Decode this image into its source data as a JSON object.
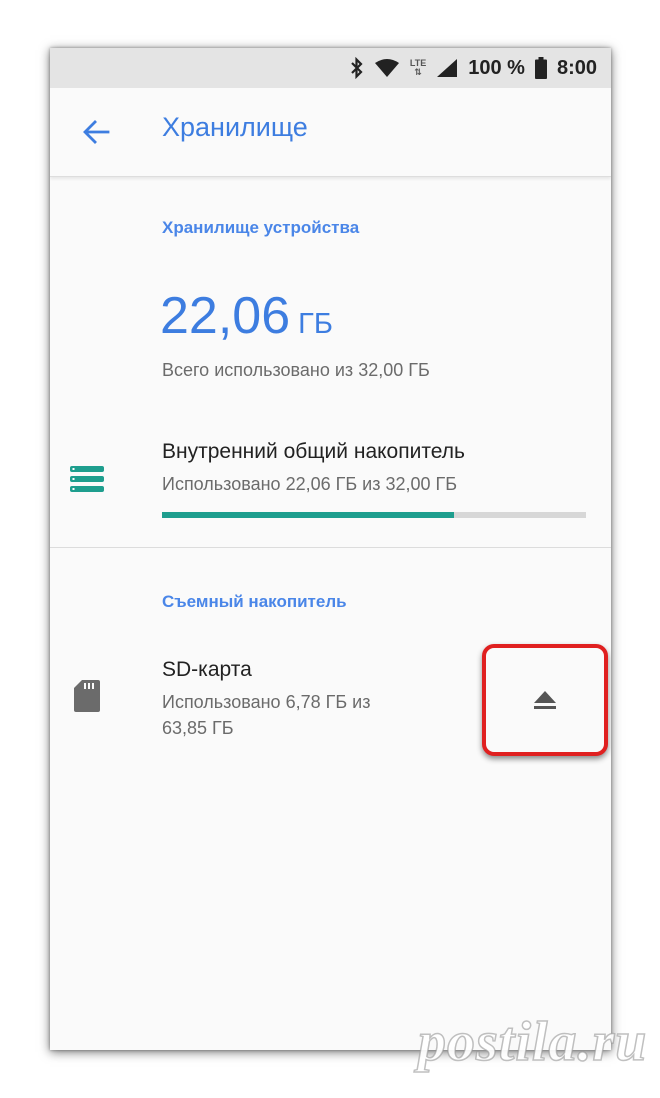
{
  "status_bar": {
    "icons": [
      "bluetooth-icon",
      "wifi-icon",
      "lte-icon",
      "signal-icon",
      "battery-icon"
    ],
    "lte_label": "LTE",
    "battery": "100 %",
    "time": "8:00"
  },
  "app_bar": {
    "back_icon": "arrow-left-icon",
    "title": "Хранилище"
  },
  "device_storage": {
    "header": "Хранилище устройства",
    "used_value": "22,06",
    "used_unit": "ГБ",
    "total_text": "Всего использовано из 32,00 ГБ",
    "internal": {
      "icon": "storage-list-icon",
      "title": "Внутренний общий накопитель",
      "summary": "Использовано 22,06 ГБ из 32,00 ГБ",
      "progress_percent": 68.9
    }
  },
  "removable_storage": {
    "header": "Съемный накопитель",
    "sd_card": {
      "icon": "sd-card-icon",
      "title": "SD-карта",
      "summary_line1": "Использовано 6,78 ГБ из",
      "summary_line2": "63,85 ГБ",
      "eject_icon": "eject-icon"
    }
  },
  "watermark": "postila.ru",
  "colors": {
    "accent": "#3d7de0",
    "progress": "#1e9e8e",
    "highlight": "#e02020"
  }
}
